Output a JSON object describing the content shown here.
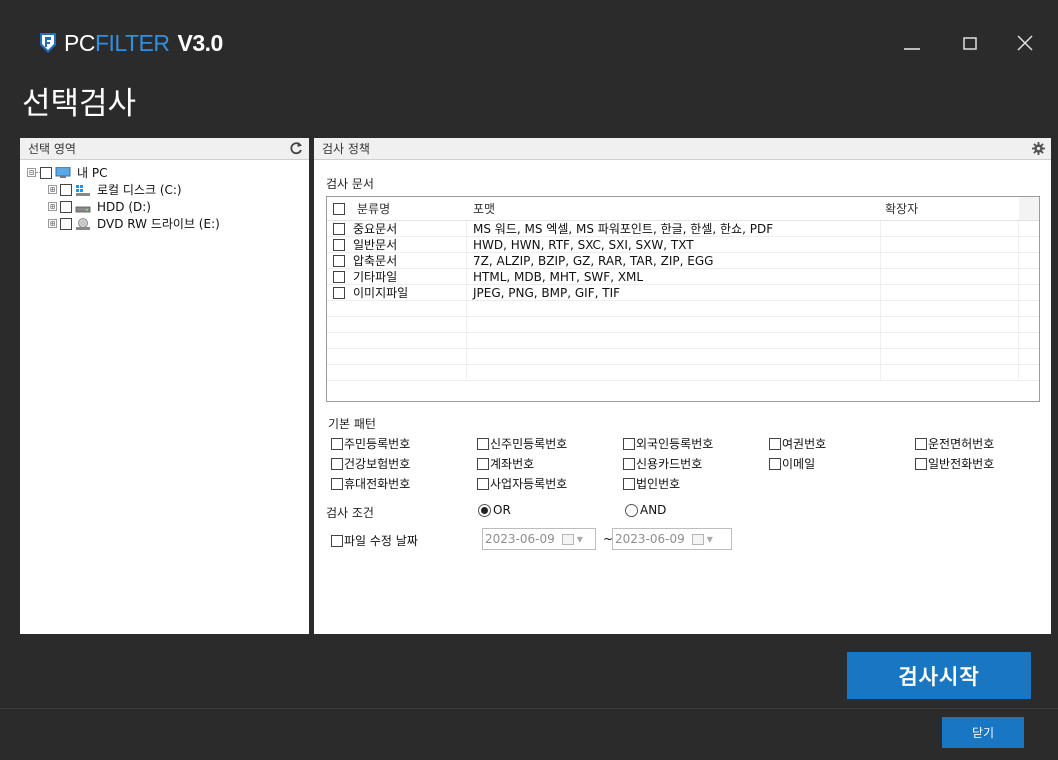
{
  "app": {
    "logo_pc": "PC",
    "logo_filter": "FILTER",
    "logo_version": "V3.0",
    "page_title": "선택검사",
    "brand_color": "#1976c2",
    "accent_color": "#2f8fe0"
  },
  "window_controls": {
    "minimize_icon": "minimize-icon",
    "maximize_icon": "maximize-icon",
    "close_icon": "close-icon"
  },
  "left_panel": {
    "title": "선택 영역",
    "refresh_icon": "refresh-icon",
    "tree": {
      "root": {
        "label": "내 PC",
        "expander": "⊟",
        "icon": "computer-icon"
      },
      "children": [
        {
          "label": "로컬 디스크 (C:)",
          "expander": "⊞",
          "icon": "windows-drive-icon"
        },
        {
          "label": "HDD (D:)",
          "expander": "⊞",
          "icon": "hard-drive-icon"
        },
        {
          "label": "DVD RW 드라이브 (E:)",
          "expander": "⊞",
          "icon": "dvd-drive-icon"
        }
      ]
    }
  },
  "right_panel": {
    "title": "검사 정책",
    "settings_icon": "gear-icon",
    "documents": {
      "title": "검사 문서",
      "columns": [
        "분류명",
        "포맷",
        "확장자"
      ],
      "rows": [
        {
          "name": "중요문서",
          "formats": "MS 워드, MS 엑셀, MS 파워포인트, 한글, 한셀, 한쇼, PDF",
          "ext": ""
        },
        {
          "name": "일반문서",
          "formats": "HWD, HWN, RTF, SXC, SXI, SXW, TXT",
          "ext": ""
        },
        {
          "name": "압축문서",
          "formats": "7Z, ALZIP, BZIP, GZ, RAR, TAR, ZIP, EGG",
          "ext": ""
        },
        {
          "name": "기타파일",
          "formats": "HTML, MDB, MHT, SWF, XML",
          "ext": ""
        },
        {
          "name": "이미지파일",
          "formats": "JPEG, PNG, BMP, GIF, TIF",
          "ext": ""
        }
      ]
    },
    "patterns": {
      "title": "기본 패턴",
      "items": [
        "주민등록번호",
        "신주민등록번호",
        "외국인등록번호",
        "여권번호",
        "운전면허번호",
        "건강보험번호",
        "계좌번호",
        "신용카드번호",
        "이메일",
        "일반전화번호",
        "휴대전화번호",
        "사업자등록번호",
        "법인번호"
      ]
    },
    "condition": {
      "label": "검사 조건",
      "or_label": "OR",
      "and_label": "AND",
      "selected": "OR"
    },
    "date_filter": {
      "label": "파일 수정 날짜",
      "from": "2023-06-09",
      "separator": "~",
      "to": "2023-06-09"
    }
  },
  "buttons": {
    "start": "검사시작",
    "close": "닫기"
  }
}
